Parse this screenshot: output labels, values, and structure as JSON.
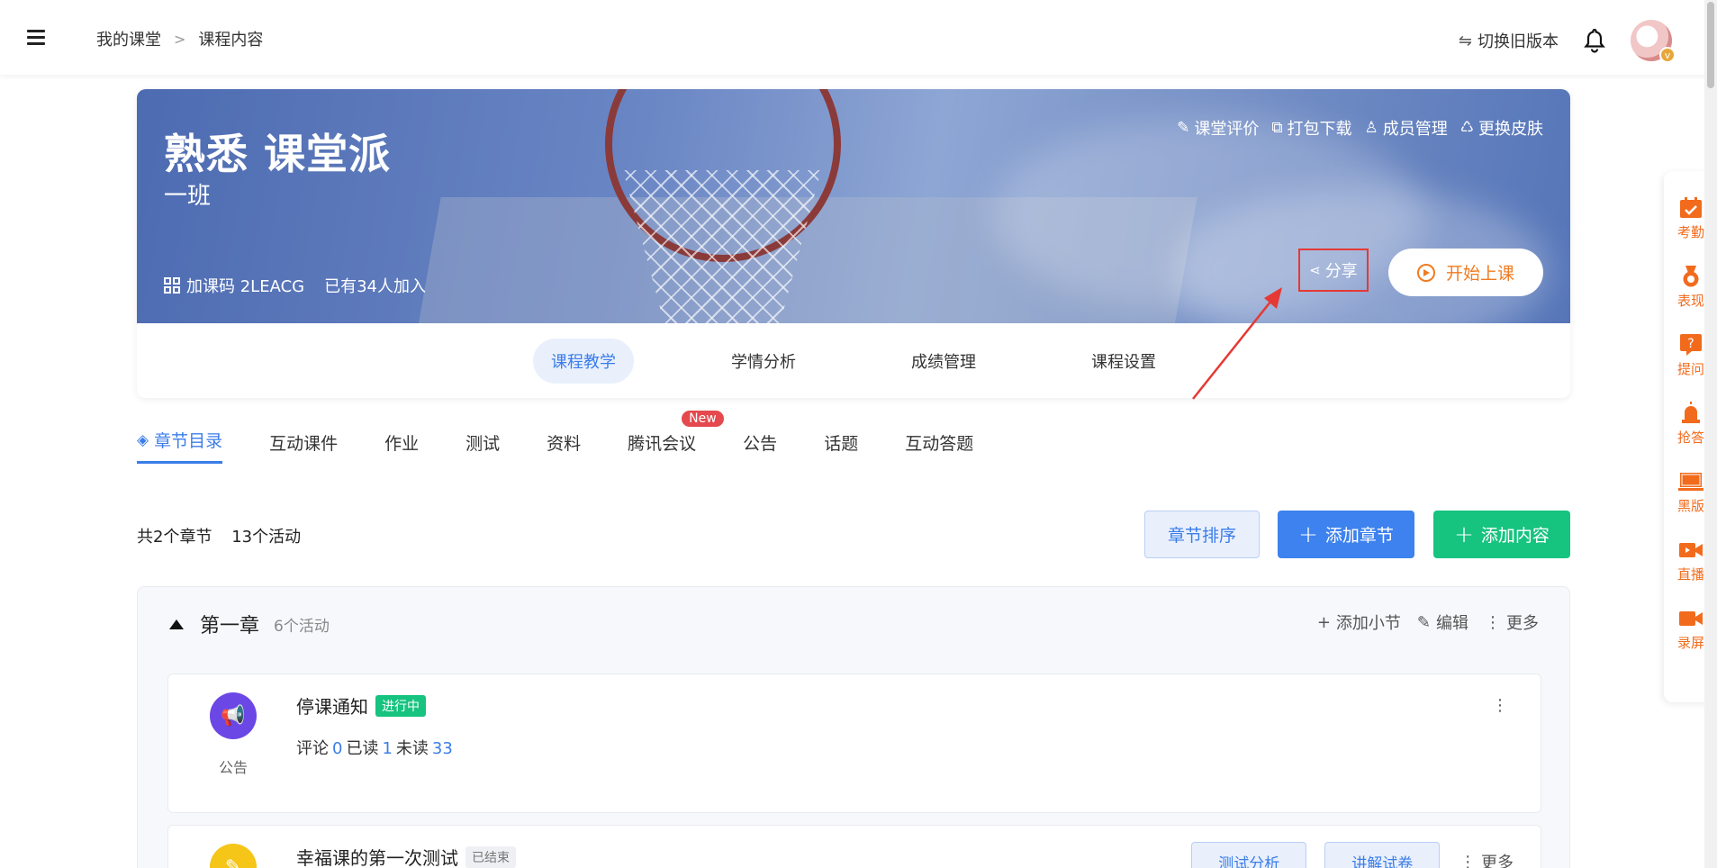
{
  "breadcrumb": {
    "home": "我的课堂",
    "current": "课程内容"
  },
  "topbar": {
    "switch_version": "切换旧版本"
  },
  "course": {
    "title": "熟悉 课堂派",
    "class_name": "一班",
    "join_code": "加课码 2LEACG",
    "joined": "已有34人加入",
    "actions": [
      "课堂评价",
      "打包下载",
      "成员管理",
      "更换皮肤"
    ],
    "share": "分享",
    "start_class": "开始上课"
  },
  "course_tabs": [
    "课程教学",
    "学情分析",
    "成绩管理",
    "课程设置"
  ],
  "sub_tabs": [
    "章节目录",
    "互动课件",
    "作业",
    "测试",
    "资料",
    "腾讯会议",
    "公告",
    "话题",
    "互动答题"
  ],
  "new_badge": "New",
  "summary": {
    "chapters": "共2个章节",
    "activities": "13个活动"
  },
  "buttons": {
    "sort": "章节排序",
    "add_chapter": "添加章节",
    "add_content": "添加内容"
  },
  "chapter": {
    "title": "第一章",
    "count": "6个活动",
    "actions": [
      "添加小节",
      "编辑",
      "更多"
    ]
  },
  "activities": [
    {
      "title": "停课通知",
      "status": "进行中",
      "type": "公告",
      "stats": {
        "comment_label": "评论",
        "comment": "0",
        "read_label": "已读",
        "read": "1",
        "unread_label": "未读",
        "unread": "33"
      }
    },
    {
      "title": "幸福课的第一次测试",
      "status": "已结束",
      "buttons": [
        "测试分析",
        "讲解试卷"
      ],
      "more": "更多"
    }
  ],
  "side_tools": [
    "考勤",
    "表现",
    "提问",
    "抢答",
    "黑版",
    "直播",
    "录屏"
  ],
  "colors": {
    "accent": "#3b7de9",
    "green": "#16c37f",
    "orange": "#f26b1d",
    "annotation": "#e53935"
  }
}
